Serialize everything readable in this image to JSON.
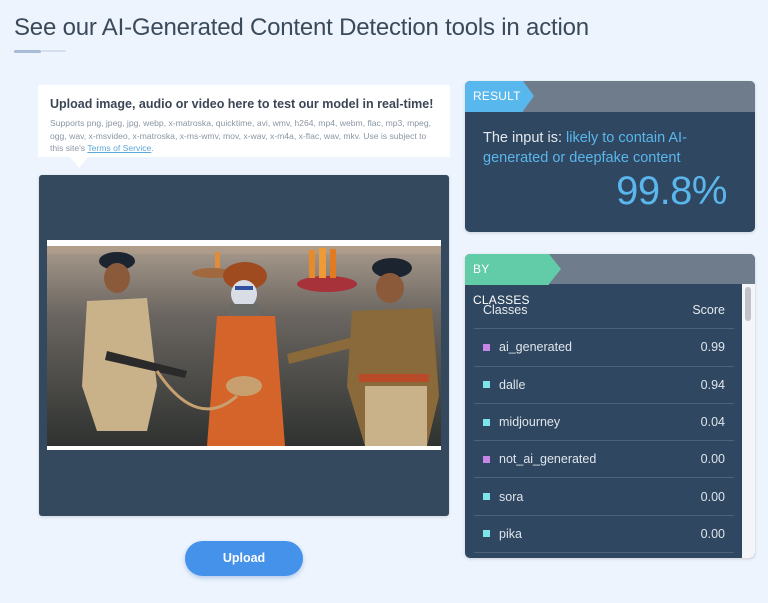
{
  "page": {
    "title": "See our AI-Generated Content Detection tools in action"
  },
  "upload": {
    "heading": "Upload image, audio or video here to test our model in real-time!",
    "supports_text": "Supports png, jpeg, jpg, webp, x-matroska, quicktime, avi, wmv, h264, mp4, webm, flac, mp3, mpeg, ogg, wav, x-msvideo, x-matroska, x-ms-wmv, mov, x-wav, x-m4a, x-flac, wav, mkv. Use is subject to this site's ",
    "terms_link": "Terms of Service",
    "terms_suffix": ".",
    "preview_alt": "Uploaded image: two police officers leading a sadhu with face paint through river water, boats in background",
    "button_label": "Upload"
  },
  "result": {
    "tab_label": "RESULT",
    "prefix": "The input is: ",
    "verdict": "likely to contain AI-generated or deepfake content",
    "score": "99.8%"
  },
  "classes": {
    "tab_label": "BY CLASSES",
    "col_class": "Classes",
    "col_score": "Score",
    "rows": [
      {
        "name": "ai_generated",
        "score": "0.99",
        "color": "#c984e8"
      },
      {
        "name": "dalle",
        "score": "0.94",
        "color": "#7fe3ec"
      },
      {
        "name": "midjourney",
        "score": "0.04",
        "color": "#7fe3ec"
      },
      {
        "name": "not_ai_generated",
        "score": "0.00",
        "color": "#c984e8"
      },
      {
        "name": "sora",
        "score": "0.00",
        "color": "#7fe3ec"
      },
      {
        "name": "pika",
        "score": "0.00",
        "color": "#7fe3ec"
      }
    ]
  },
  "colors": {
    "accent_blue": "#5ab6ec",
    "accent_green": "#62cba8",
    "button_blue": "#4592ea",
    "panel_dark": "#2f4760"
  }
}
